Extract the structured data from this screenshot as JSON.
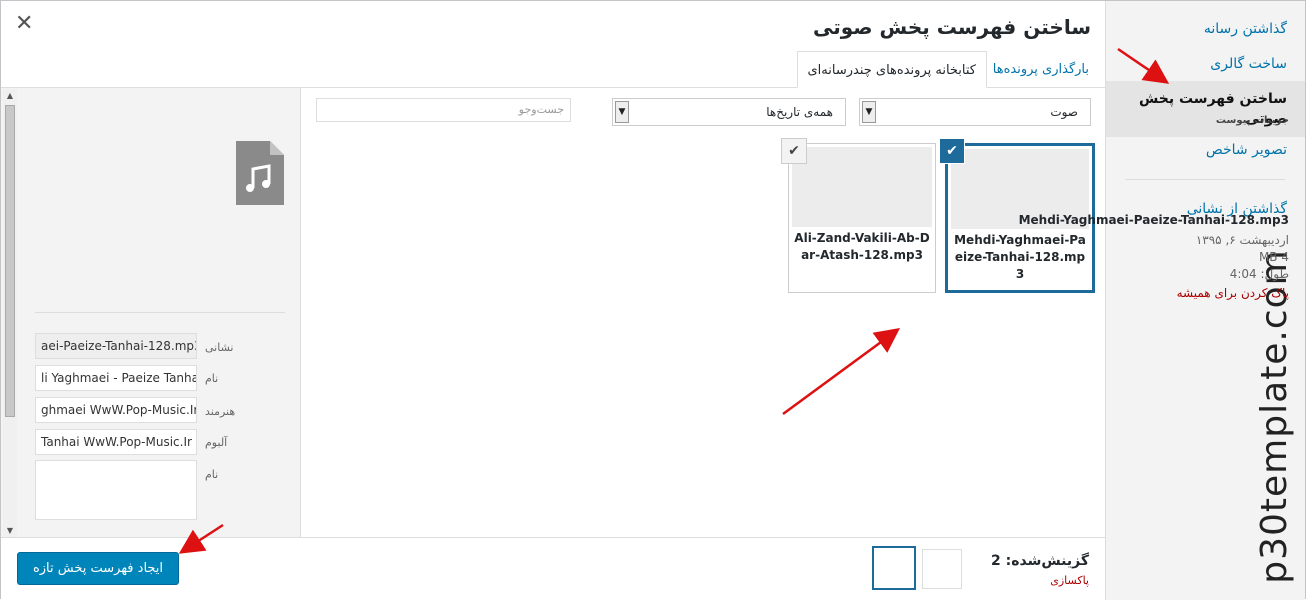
{
  "title": "ساختن فهرست پخش صوتی",
  "menu": {
    "items": [
      {
        "label": "گذاشتن رسانه"
      },
      {
        "label": "ساخت گالری"
      },
      {
        "label": "ساختن فهرست پخش صوتی"
      },
      {
        "label": "تصویر شاخص"
      },
      {
        "label": "گذاشتن از نشانی"
      }
    ]
  },
  "watermark": "p30template.com",
  "tabs": {
    "upload": "بارگذاری پرونده‌ها",
    "library": "کتابخانه پرونده‌های چندرسانه‌ای"
  },
  "filters": {
    "type_value": "صوت",
    "date_value": "همه‌ی تاریخ‌ها",
    "search_placeholder": "جست‌وجو"
  },
  "attachments": [
    {
      "name": "Mehdi-Yaghmaei-Paeize-Tanhai-128.mp3",
      "selected": true
    },
    {
      "name": "Ali-Zand-Vakili-Ab-Dar-Atash-128.mp3",
      "selected": true
    }
  ],
  "details": {
    "heading": "جزییات پیوست",
    "filename": "Mehdi-Yaghmaei-Paeize-Tanhai-128.mp3",
    "date": "اردیبهشت ۶, ۱۳۹۵",
    "size": "4 MB",
    "length": "طول: 4:04",
    "delete_link": "پاک کردن برای همیشه",
    "fields": {
      "url_label": "نشانی",
      "url_value": "aei-Paeize-Tanhai-128.mp3",
      "title_label": "نام",
      "title_value": "li Yaghmaei - Paeize Tanhai",
      "artist_label": "هنرمند",
      "artist_value": "ghmaei WwW.Pop-Music.Ir",
      "album_label": "آلبوم",
      "album_value": "Tanhai WwW.Pop-Music.Ir",
      "caption_label": "نام"
    }
  },
  "toolbar": {
    "selected_count": "گزینش‌شده: 2",
    "clear_label": "پاکسازی",
    "create_button": "ایجاد فهرست پخش تازه"
  },
  "colors": {
    "accent": "#0085ba",
    "selection_border": "#1e6b9b",
    "danger": "#aa0000",
    "annotation_arrow": "#dd1111"
  }
}
